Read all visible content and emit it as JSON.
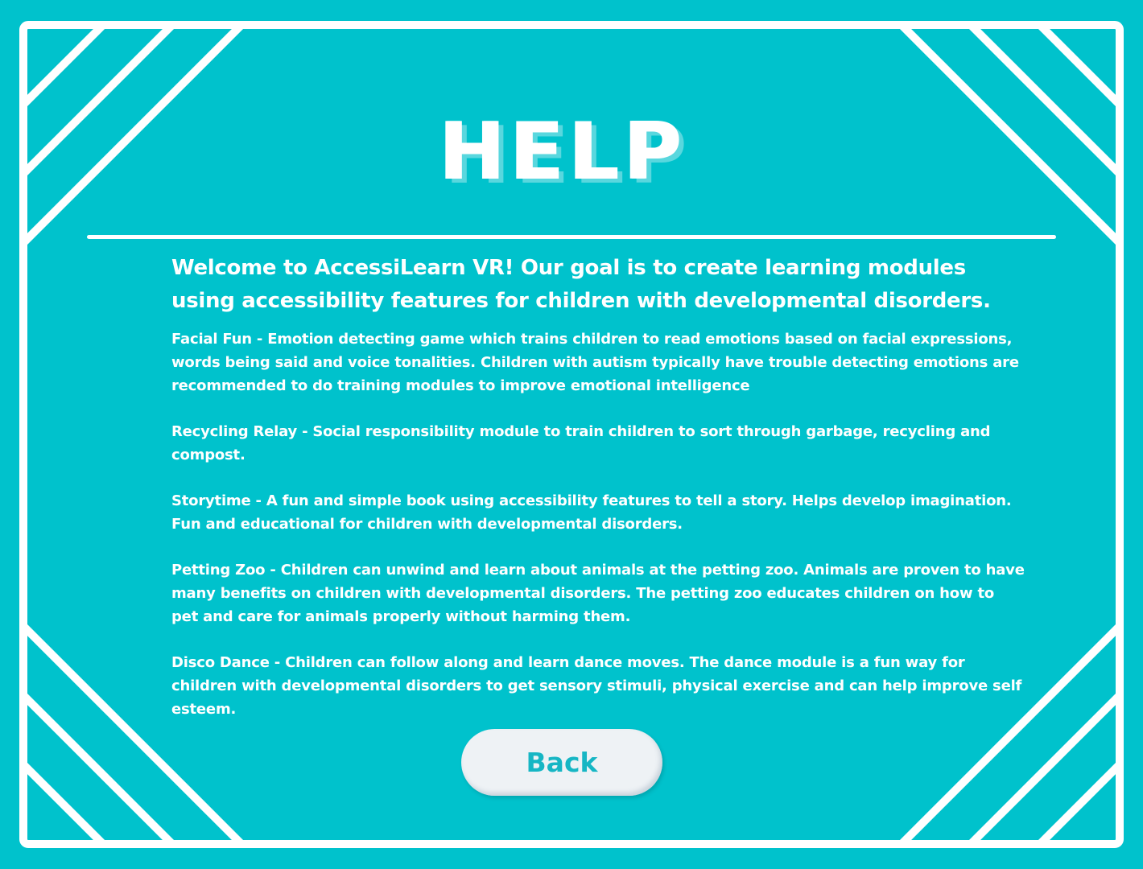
{
  "colors": {
    "background": "#00c2cc",
    "frame": "#ffffff",
    "text": "#ffffff",
    "button_background": "#eef2f5",
    "button_text": "#16b6c4"
  },
  "header": {
    "title": "HELP"
  },
  "intro": "Welcome to AccessiLearn VR! Our goal is to create learning modules using accessibility features for children with developmental disorders.",
  "modules": [
    {
      "name": "Facial Fun",
      "description": "Facial Fun - Emotion detecting game which trains children to read emotions based on facial expressions, words being said and voice tonalities. Children with autism typically have trouble detecting emotions are recommended to do training modules to improve emotional intelligence"
    },
    {
      "name": "Recycling Relay",
      "description": "Recycling Relay - Social responsibility module to train children to sort through garbage, recycling and compost."
    },
    {
      "name": "Storytime",
      "description": "Storytime - A fun and simple book using accessibility features to tell a story. Helps develop imagination. Fun and educational for children with developmental disorders."
    },
    {
      "name": "Petting Zoo",
      "description": "Petting Zoo - Children can unwind and learn about animals at the petting zoo. Animals are proven to have many benefits on children with developmental disorders. The petting zoo educates children on how to pet and care for animals properly without harming them."
    },
    {
      "name": "Disco Dance",
      "description": "Disco Dance - Children can follow along and learn dance moves. The dance module is a fun way for children with developmental disorders to get sensory stimuli, physical exercise and can help improve self esteem."
    }
  ],
  "back_button": {
    "label": "Back"
  }
}
